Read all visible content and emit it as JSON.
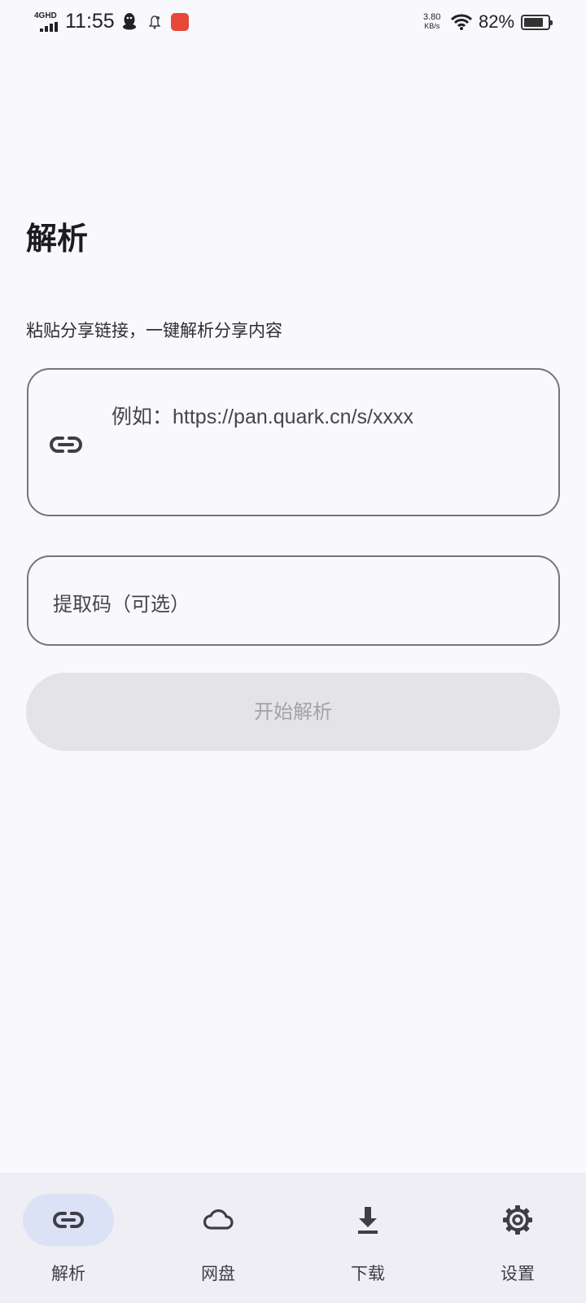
{
  "status_bar": {
    "network": "4GHD",
    "time": "11:55",
    "speed_value": "3.80",
    "speed_unit": "KB/s",
    "battery": "82%",
    "battery_level": 0.82
  },
  "page": {
    "title": "解析",
    "subtitle": "粘贴分享链接，一键解析分享内容"
  },
  "form": {
    "link_placeholder": "例如：https://pan.quark.cn/s/xxxx",
    "code_placeholder": "提取码（可选）",
    "start_button": "开始解析"
  },
  "bottom_nav": {
    "items": [
      {
        "label": "解析",
        "icon": "link-icon",
        "active": true
      },
      {
        "label": "网盘",
        "icon": "cloud-icon",
        "active": false
      },
      {
        "label": "下载",
        "icon": "download-icon",
        "active": false
      },
      {
        "label": "设置",
        "icon": "gear-icon",
        "active": false
      }
    ]
  },
  "colors": {
    "background": "#f9f8fd",
    "nav_background": "#eeeef4",
    "active_pill": "#dbe2f5",
    "button_disabled": "#e4e3e8",
    "outline": "#76757c"
  }
}
